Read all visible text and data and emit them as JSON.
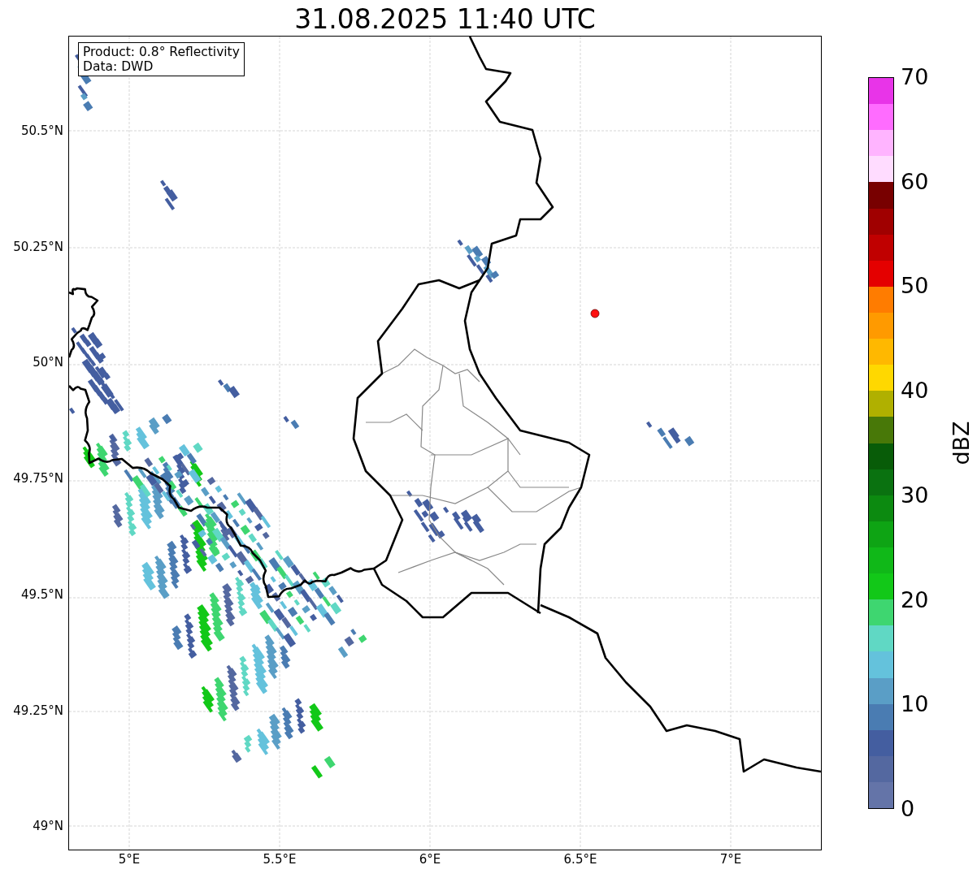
{
  "title": "31.08.2025 11:40 UTC",
  "info_box": {
    "lines": [
      "Product: 0.8° Reflectivity",
      "Data: DWD"
    ]
  },
  "map": {
    "lat_labels": [
      "50.5°N",
      "50.25°N",
      "50°N",
      "49.75°N",
      "49.5°N",
      "49.25°N",
      "49°N"
    ],
    "lon_labels": [
      "5°E",
      "5.5°E",
      "6°E",
      "6.5°E",
      "7°E"
    ]
  },
  "colorbar": {
    "label": "dBZ",
    "ticks": [
      "70",
      "60",
      "50",
      "40",
      "30",
      "20",
      "10",
      "0"
    ],
    "segments": [
      {
        "color": "#6474a8"
      },
      {
        "color": "#5468a0"
      },
      {
        "color": "#445ea0"
      },
      {
        "color": "#4a7cb2"
      },
      {
        "color": "#5a9ec6"
      },
      {
        "color": "#64c2dc"
      },
      {
        "color": "#60d8c4"
      },
      {
        "color": "#3ed670"
      },
      {
        "color": "#12c818"
      },
      {
        "color": "#10b818"
      },
      {
        "color": "#0ea414"
      },
      {
        "color": "#0c8a10"
      },
      {
        "color": "#0a7210"
      },
      {
        "color": "#085c08"
      },
      {
        "color": "#487808"
      },
      {
        "color": "#b0b000"
      },
      {
        "color": "#ffd800"
      },
      {
        "color": "#ffb800"
      },
      {
        "color": "#ff9a00"
      },
      {
        "color": "#ff7c00"
      },
      {
        "color": "#e40000"
      },
      {
        "color": "#c00000"
      },
      {
        "color": "#a00000"
      },
      {
        "color": "#780000"
      },
      {
        "color": "#ffdcff"
      },
      {
        "color": "#ffb4ff"
      },
      {
        "color": "#ff6cff"
      },
      {
        "color": "#e834e8"
      }
    ]
  }
}
